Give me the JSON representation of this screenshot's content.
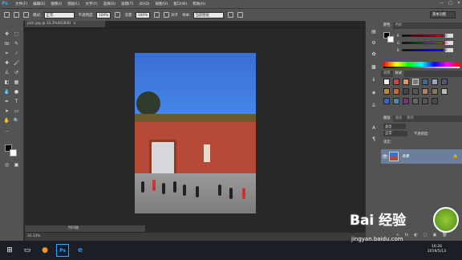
{
  "app": {
    "logo": "Ps",
    "window_controls": [
      "—",
      "□",
      "✕"
    ]
  },
  "menu": [
    "文件(F)",
    "编辑(E)",
    "图像(I)",
    "图层(L)",
    "文字(Y)",
    "选择(S)",
    "滤镜(T)",
    "3D(D)",
    "视图(V)",
    "窗口(W)",
    "帮助(H)"
  ],
  "options": {
    "mode_label": "模式:",
    "mode_value": "正常",
    "opacity_label": "不透明度:",
    "opacity_value": "100%",
    "flow_label": "流量:",
    "flow_value": "100%",
    "align_label": "对齐",
    "sample_label": "样本:",
    "sample_value": "当前图层",
    "workspace": "基本功能"
  },
  "document": {
    "tab_title": "pick.jpg @ 33.3%(RGB/8)",
    "close": "×"
  },
  "status": {
    "zoom": "33.33%",
    "tab_label": "时间轴"
  },
  "panels": {
    "color_tabs": [
      "颜色",
      "色板"
    ],
    "color_channels": [
      {
        "label": "R",
        "value": "0"
      },
      {
        "label": "G",
        "value": "0"
      },
      {
        "label": "B",
        "value": "0"
      }
    ],
    "style_tabs": [
      "调整",
      "样式"
    ],
    "layer_tabs": [
      "图层",
      "通道",
      "路径"
    ],
    "layer_kind": "类型",
    "layer_blend": "正常",
    "layer_opacity_label": "不透明度:",
    "layer_lock_label": "锁定:",
    "layer_name": "背景",
    "layer_lock_icon": "🔒",
    "layer_bottom_icons": [
      "∞",
      "fx",
      "◐",
      "▢",
      "▣",
      "🗑"
    ]
  },
  "taskbar": {
    "time": "16:26",
    "date": "2019/5/13"
  },
  "watermark": {
    "brand": "Bai 经验",
    "url": "jingyan.baidu.com"
  },
  "colors": {
    "accent": "#31a8ff",
    "layer_selected": "#6b7f9c",
    "panel_bg": "#535353",
    "canvas_bg": "#282828"
  }
}
